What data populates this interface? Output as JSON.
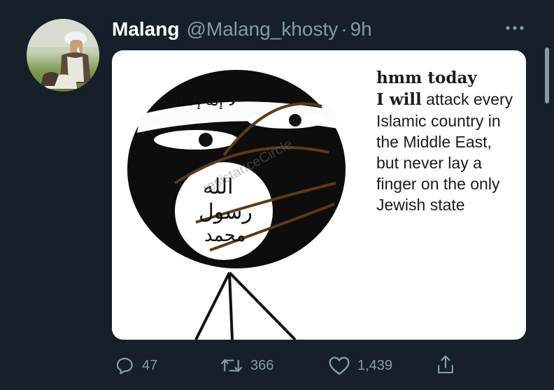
{
  "tweet": {
    "author_name": "Malang",
    "handle": "@Malang_khosty",
    "separator": "·",
    "time": "9h",
    "more_icon": "more-horizontal-icon"
  },
  "media": {
    "caption_bold": "hmm today",
    "caption_bold_2": "I will",
    "caption_rest": " attack every Islamic country in the Middle East, but never lay a finger on the only Jewish state",
    "banner_text": "ﻻ إله إلا الله",
    "seal_line_1": "الله",
    "seal_line_2": "رسول",
    "seal_line_3": "محمد",
    "watermark": "resistanceCircle"
  },
  "actions": {
    "reply_count": "47",
    "retweet_count": "366",
    "like_count": "1,439",
    "reply_icon": "reply-icon",
    "retweet_icon": "retweet-icon",
    "like_icon": "heart-icon",
    "share_icon": "share-icon"
  },
  "colors": {
    "background": "#15202b",
    "secondary_text": "#8899a6"
  }
}
